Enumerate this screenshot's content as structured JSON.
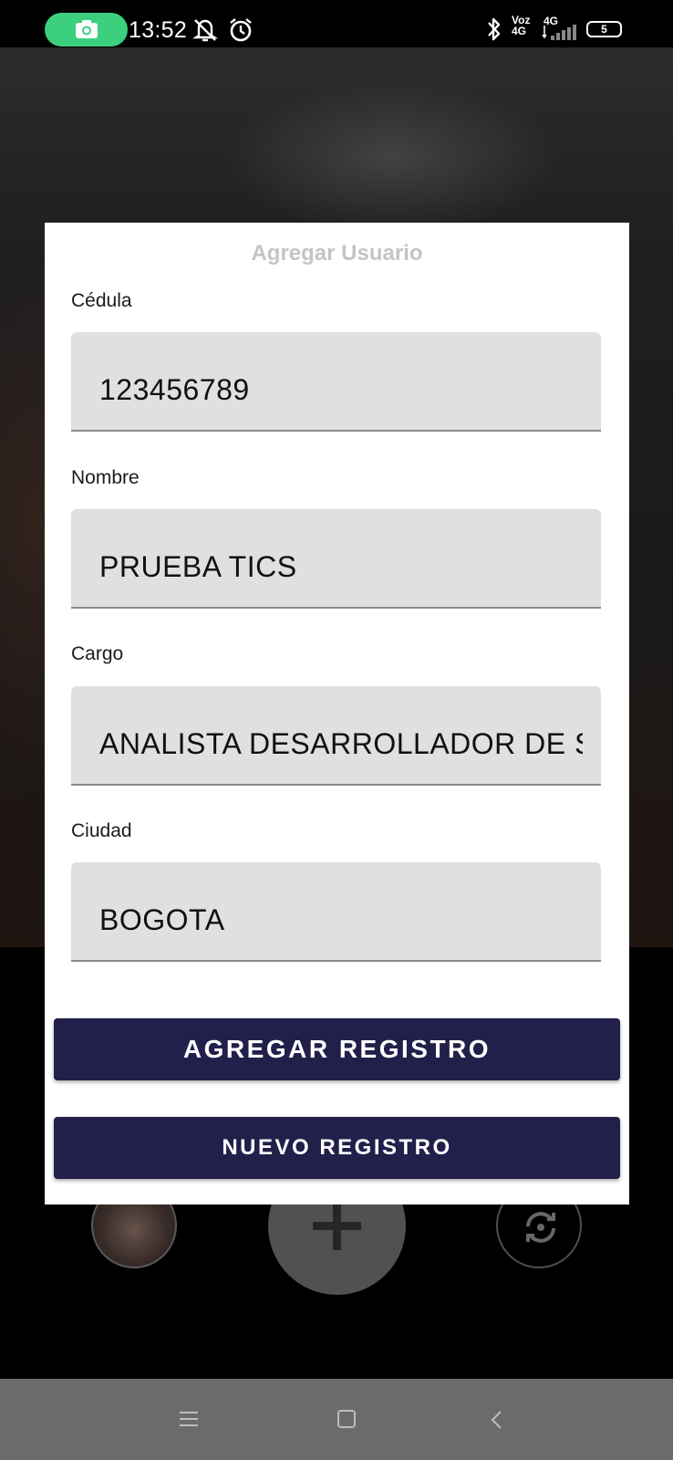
{
  "status_bar": {
    "time": "13:52",
    "network_voz": "Voz",
    "network_voz_sub": "4G",
    "network_type": "4G",
    "battery_level": "5",
    "icons": [
      "screen-record-icon",
      "mute-icon",
      "alarm-icon",
      "bluetooth-icon",
      "signal-icon",
      "battery-icon"
    ]
  },
  "modal": {
    "title": "Agregar Usuario",
    "fields": [
      {
        "label": "Cédula",
        "value": "123456789"
      },
      {
        "label": "Nombre",
        "value": "PRUEBA TICS"
      },
      {
        "label": "Cargo",
        "value": "ANALISTA DESARROLLADOR DE S"
      },
      {
        "label": "Ciudad",
        "value": "BOGOTA"
      }
    ],
    "primary_button": "AGREGAR REGISTRO",
    "secondary_button": "NUEVO REGISTRO"
  },
  "camera": {
    "icons": [
      "gallery-thumbnail",
      "add-icon",
      "switch-camera-icon"
    ]
  },
  "nav_bar": {
    "icons": [
      "menu-icon",
      "home-icon",
      "back-icon"
    ]
  },
  "colors": {
    "button_bg": "#22204a",
    "record_pill": "#3bcf7e",
    "field_bg": "#e0e0e0",
    "title_text": "#c4c4c4"
  }
}
